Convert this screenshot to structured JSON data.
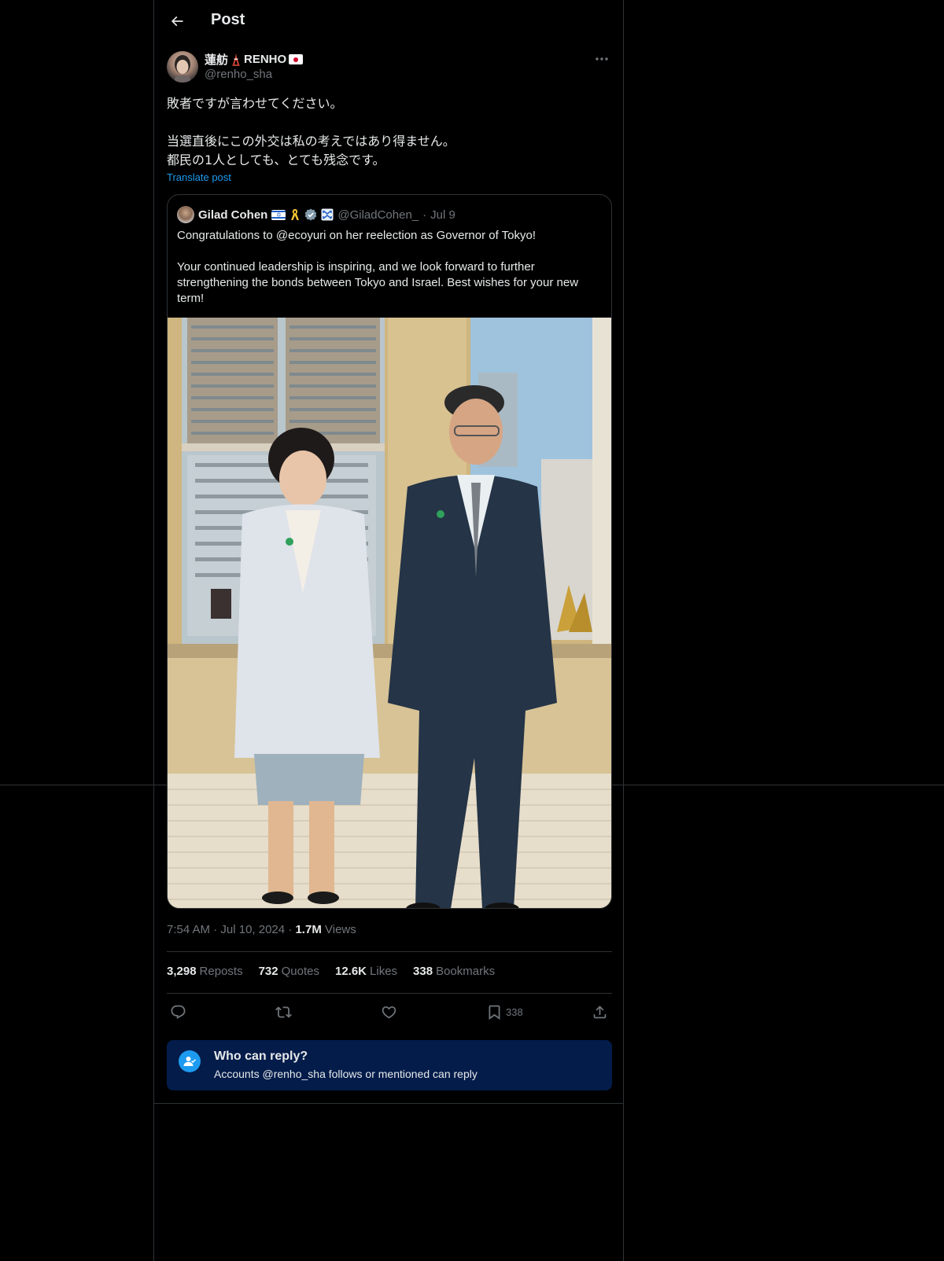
{
  "header": {
    "title": "Post",
    "back_icon": "arrow-left-icon"
  },
  "post": {
    "author_name": "蓮舫",
    "author_name_suffix": "RENHO",
    "author_handle": "@renho_sha",
    "text_lines": [
      "敗者ですが言わせてください。",
      "",
      "当選直後にこの外交は私の考えではあり得ません。",
      "都民の1人としても、とても残念です。"
    ],
    "translate_label": "Translate post",
    "timestamp_time": "7:54 AM",
    "timestamp_date": "Jul 10, 2024",
    "views_count": "1.7M",
    "views_label": "Views",
    "separator": "·"
  },
  "quote": {
    "author_name": "Gilad Cohen",
    "author_handle": "@GiladCohen_",
    "date": "Jul 9",
    "separator": "·",
    "text_line1": "Congratulations to @ecoyuri on her reelection as Governor of Tokyo!",
    "text_line2": "Your continued leadership is inspiring, and we look forward to further strengthening the bonds between Tokyo and Israel. Best wishes for your new term!"
  },
  "stats": {
    "reposts_count": "3,298",
    "reposts_label": "Reposts",
    "quotes_count": "732",
    "quotes_label": "Quotes",
    "likes_count": "12.6K",
    "likes_label": "Likes",
    "bookmarks_count": "338",
    "bookmarks_label": "Bookmarks"
  },
  "actions": {
    "bookmark_count": "338"
  },
  "reply_banner": {
    "title": "Who can reply?",
    "subtitle": "Accounts @renho_sha follows or mentioned can reply"
  },
  "colors": {
    "background": "#000000",
    "text_primary": "#e7e9ea",
    "text_secondary": "#71767b",
    "border": "#2f3336",
    "accent": "#1d9bf0",
    "reply_banner_bg": "#031c4a"
  }
}
